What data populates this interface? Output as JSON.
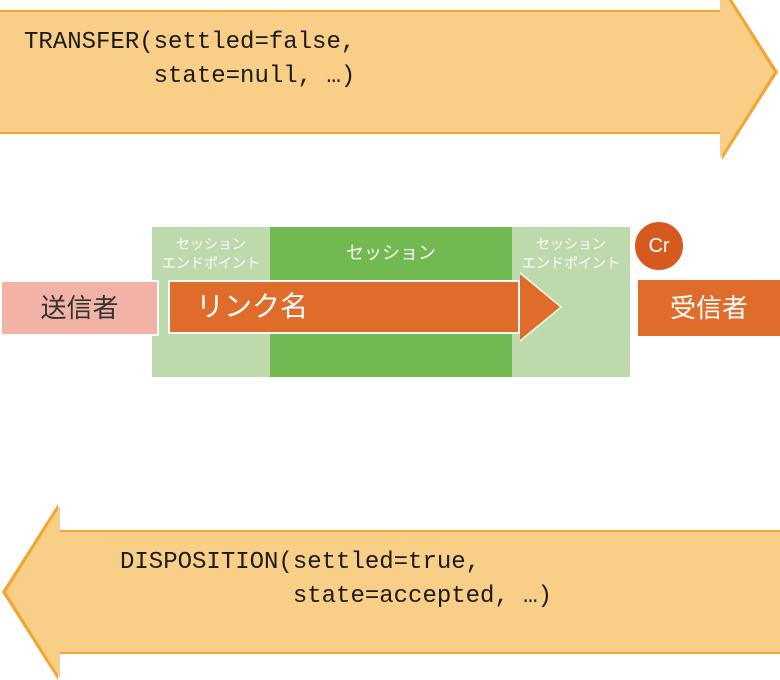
{
  "top_arrow": {
    "line1": "TRANSFER(settled=false,",
    "line2": "         state=null, …)"
  },
  "bottom_arrow": {
    "line1": "DISPOSITION(settled=true,",
    "line2": "            state=accepted, …)"
  },
  "sender": "送信者",
  "receiver": "受信者",
  "session": {
    "label": "セッション",
    "endpoint_left_l1": "セッション",
    "endpoint_left_l2": "エンドポイント",
    "endpoint_right_l1": "セッション",
    "endpoint_right_l2": "エンドポイント"
  },
  "link_name": "リンク名",
  "credit": "Cr",
  "colors": {
    "arrow_fill": "#f9ce87",
    "arrow_border": "#f2a530",
    "orange": "#e06c2c",
    "sender_fill": "#f2b3a6",
    "session_outer": "#bedaad",
    "session_inner": "#73b951"
  }
}
